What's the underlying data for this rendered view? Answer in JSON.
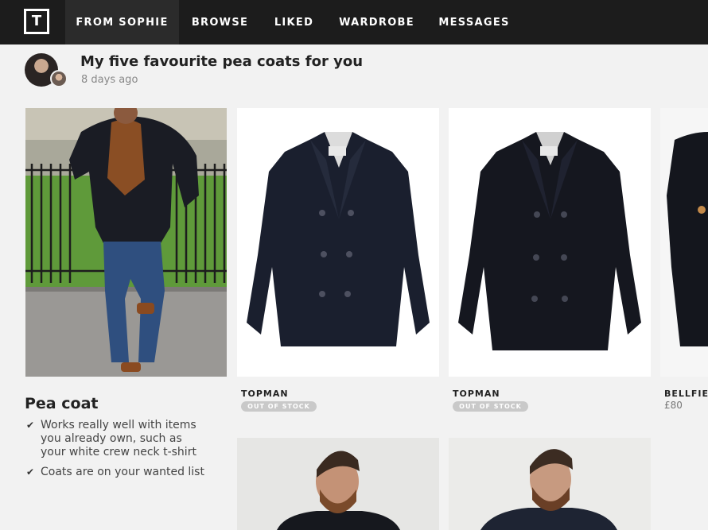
{
  "nav": {
    "logo": "T",
    "items": [
      {
        "label": "FROM SOPHIE",
        "active": true
      },
      {
        "label": "BROWSE",
        "active": false
      },
      {
        "label": "LIKED",
        "active": false
      },
      {
        "label": "WARDROBE",
        "active": false
      },
      {
        "label": "MESSAGES",
        "active": false
      }
    ]
  },
  "post": {
    "title": "My five favourite pea coats for you",
    "time": "8 days ago"
  },
  "description": {
    "title": "Pea coat",
    "points": [
      "Works really well with items you already own, such as your white crew neck t-shirt",
      "Coats are on your wanted list"
    ],
    "check_icon": "check-icon"
  },
  "products": [
    {
      "brand": "TOPMAN",
      "status": "OUT OF STOCK"
    },
    {
      "brand": "TOPMAN",
      "status": "OUT OF STOCK"
    },
    {
      "brand": "BELLFIEL",
      "price": "£80"
    }
  ],
  "colors": {
    "nav_bg": "#1c1c1c",
    "nav_active_bg": "#2b2b2b",
    "page_bg": "#f2f2f2",
    "coat_navy": "#1a1f2e",
    "badge_bg": "#c9c9c9"
  }
}
